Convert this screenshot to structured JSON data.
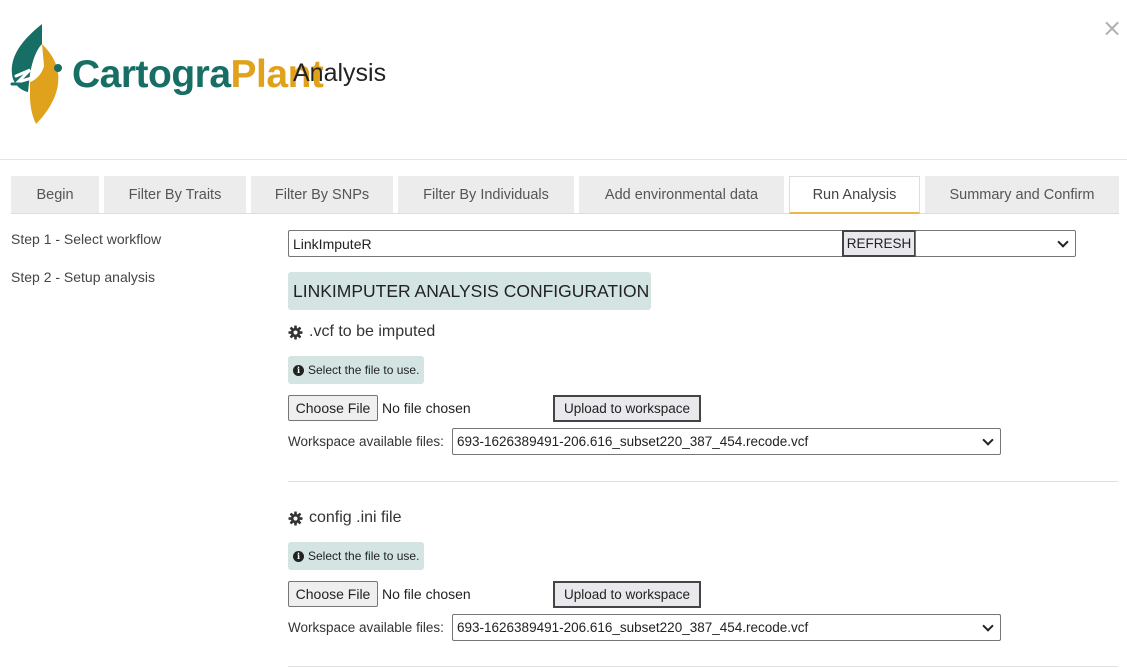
{
  "window": {
    "close_label": "×"
  },
  "header": {
    "logo_part1": "Cartogra",
    "logo_part2": "Plant",
    "subtitle": "Analysis"
  },
  "tabs": [
    {
      "label": "Begin"
    },
    {
      "label": "Filter By Traits"
    },
    {
      "label": "Filter By SNPs"
    },
    {
      "label": "Filter By Individuals"
    },
    {
      "label": "Add environmental data"
    },
    {
      "label": "Run Analysis",
      "active": true
    },
    {
      "label": "Summary and Confirm"
    }
  ],
  "steps": [
    {
      "label": "Step 1 - Select workflow"
    },
    {
      "label": "Step 2 - Setup analysis"
    }
  ],
  "workflow": {
    "input_value": "LinkImputeR",
    "refresh_label": "REFRESH",
    "select_value": ""
  },
  "config": {
    "title": "LINKIMPUTER ANALYSIS CONFIGURATION",
    "sections": [
      {
        "title": ".vcf to be imputed",
        "info": "Select the file to use.",
        "choose_label": "Choose File",
        "no_file": "No file chosen",
        "upload_label": "Upload to workspace",
        "workspace_label": "Workspace available files:",
        "workspace_value": "693-1626389491-206.616_subset220_387_454.recode.vcf"
      },
      {
        "title": "config .ini file",
        "info": "Select the file to use.",
        "choose_label": "Choose File",
        "no_file": "No file chosen",
        "upload_label": "Upload to workspace",
        "workspace_label": "Workspace available files:",
        "workspace_value": "693-1626389491-206.616_subset220_387_454.recode.vcf"
      }
    ]
  },
  "colors": {
    "brand_green": "#166e65",
    "brand_gold": "#e0a21c",
    "panel_teal": "#d3e4e2",
    "active_tab_accent": "#e8b84a"
  },
  "icons": {
    "close": "close-icon",
    "gear": "gear-icon",
    "info": "info-icon",
    "dropdown": "chevron-down-icon"
  }
}
